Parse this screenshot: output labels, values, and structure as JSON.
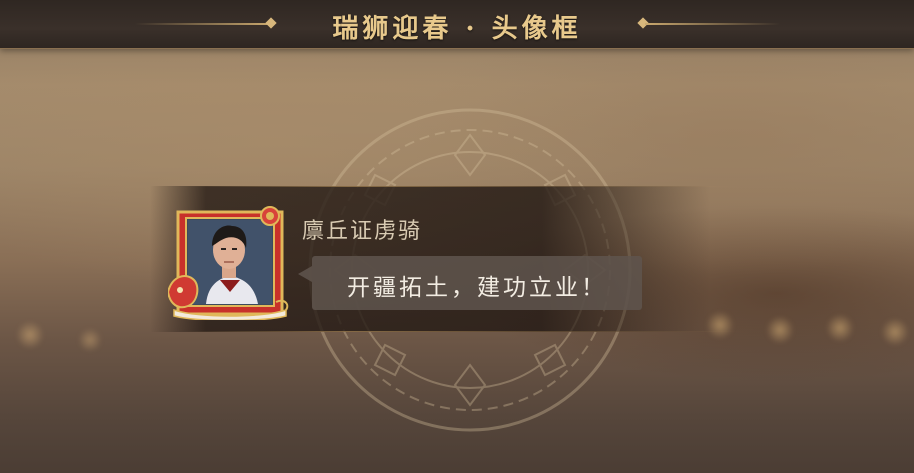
{
  "header": {
    "title": "瑞狮迎春 · 头像框"
  },
  "preview": {
    "character_name": "廪丘证虏骑",
    "speech": "开疆拓土，建功立业！"
  },
  "colors": {
    "title_gold": "#e8c98c",
    "frame_red": "#c8312a",
    "frame_gold": "#e0b85a",
    "bubble": "#5f554e"
  },
  "icons": {
    "frame": "lion-dance-avatar-frame",
    "portrait": "young-man-portrait"
  }
}
